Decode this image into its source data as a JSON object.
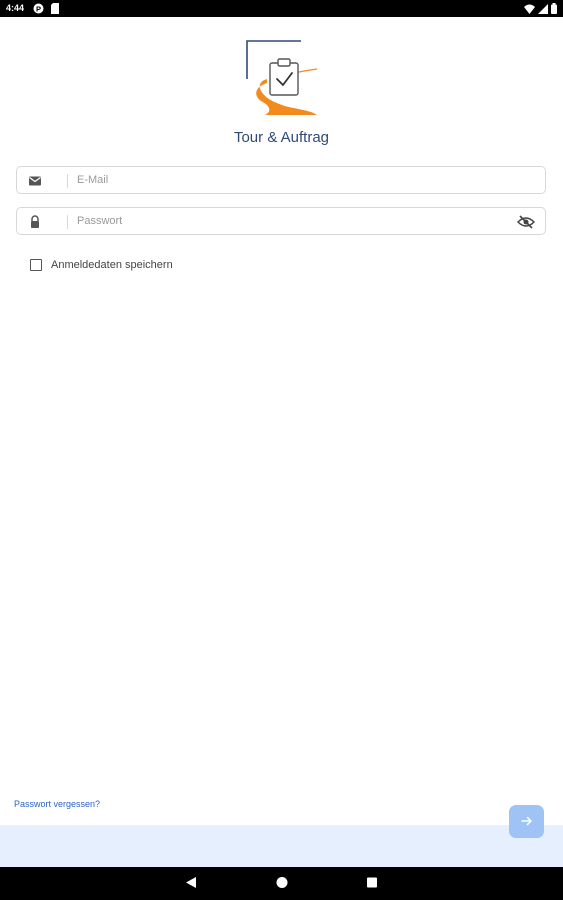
{
  "status_bar": {
    "time": "4:44",
    "left_icons": [
      "badge-p-icon",
      "sd-card-icon"
    ],
    "right_icons": [
      "wifi-icon",
      "signal-icon",
      "battery-icon"
    ]
  },
  "app": {
    "title": "Tour & Auftrag",
    "logo_icon": "clipboard-check-road-logo"
  },
  "login_form": {
    "email": {
      "placeholder": "E-Mail",
      "value": "",
      "icon": "mail-icon"
    },
    "password": {
      "placeholder": "Passwort",
      "value": "",
      "icon": "lock-icon",
      "toggle_icon": "eye-off-icon"
    },
    "remember": {
      "label": "Anmeldedaten speichern",
      "checked": false
    }
  },
  "footer": {
    "forgot_password": "Passwort vergessen?",
    "next_icon": "arrow-right-icon"
  },
  "navigation_bar": {
    "buttons": [
      "back-icon",
      "home-icon",
      "recents-icon"
    ]
  },
  "colors": {
    "title": "#2f4a7a",
    "link": "#2b63c9",
    "next_button": "#9fc3f5",
    "bottom_band": "#e5effd",
    "logo_accent": "#f28a1e",
    "logo_line": "#2f4a7a"
  }
}
